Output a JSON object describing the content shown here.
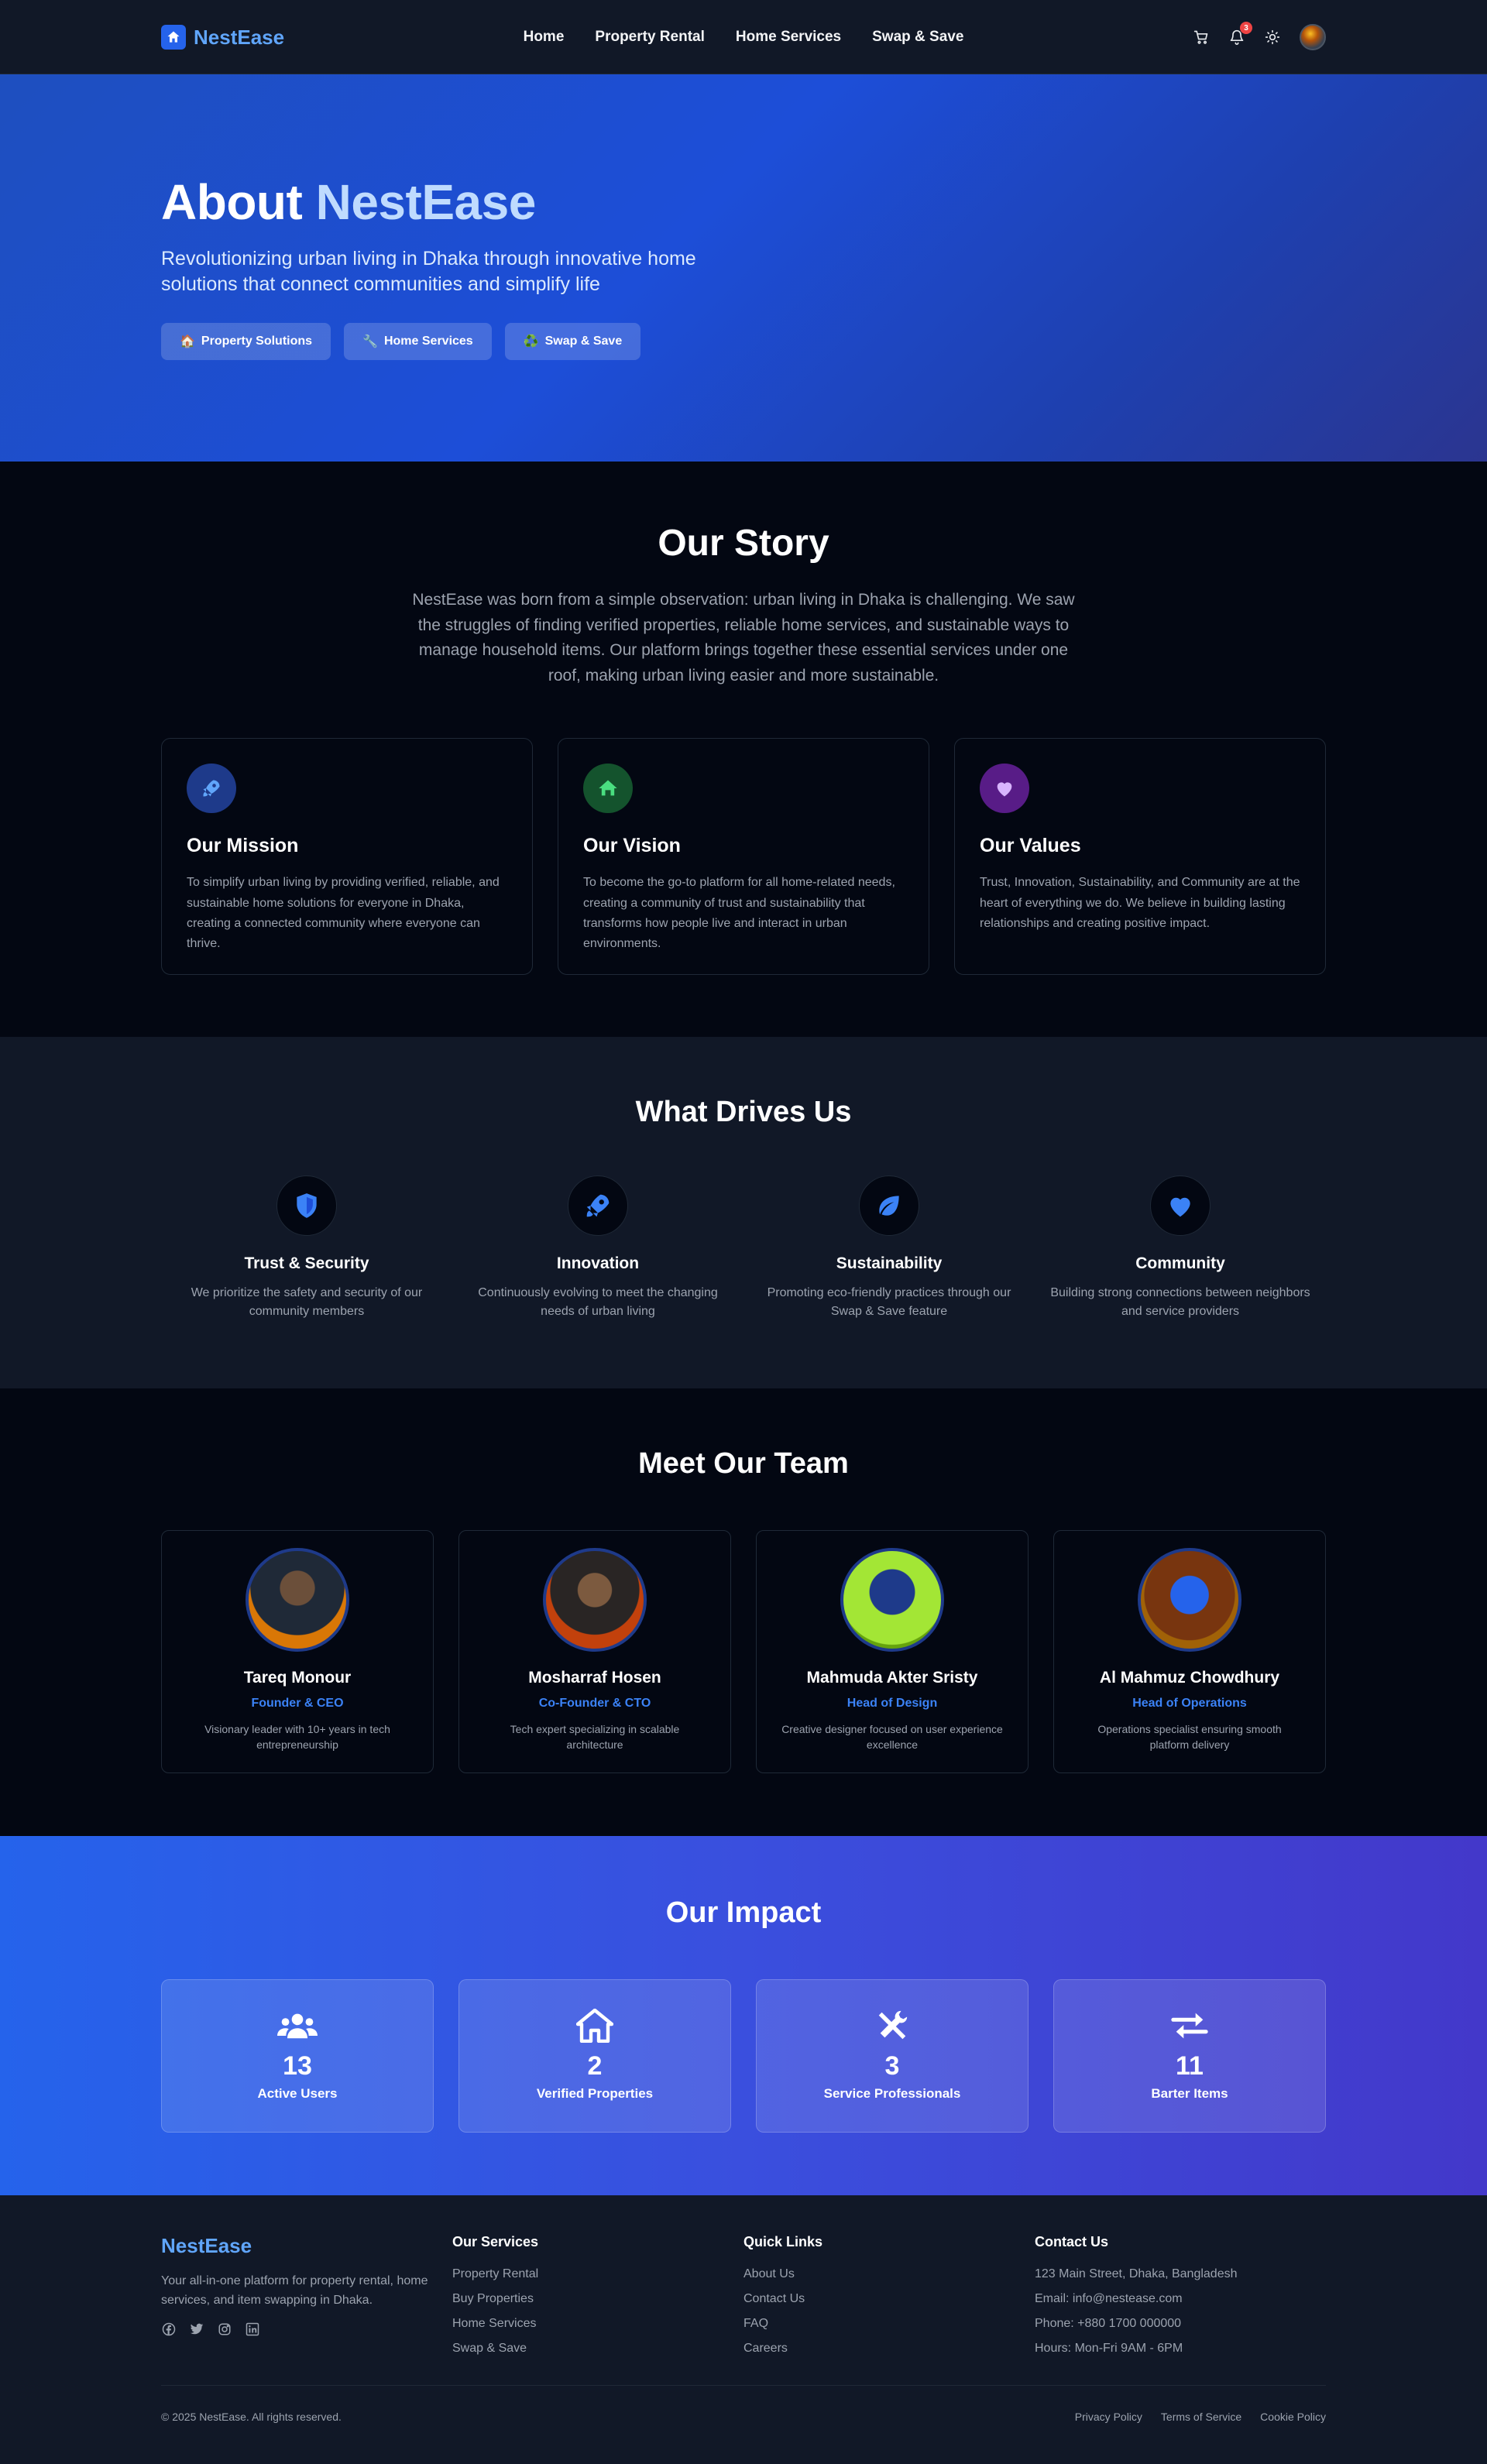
{
  "nav": {
    "brand": "NestEase",
    "links": [
      "Home",
      "Property Rental",
      "Home Services",
      "Swap & Save"
    ],
    "notification_count": "3",
    "icons": [
      "cart-icon",
      "bell-icon",
      "sun-icon",
      "avatar"
    ]
  },
  "hero": {
    "title_prefix": "About",
    "title_accent": "NestEase",
    "subtitle": "Revolutionizing urban living in Dhaka through innovative home solutions that connect communities and simplify life",
    "pills": [
      {
        "emoji": "🏠",
        "label": "Property Solutions"
      },
      {
        "emoji": "🔧",
        "label": "Home Services"
      },
      {
        "emoji": "♻️",
        "label": "Swap & Save"
      }
    ]
  },
  "story": {
    "title": "Our Story",
    "text": "NestEase was born from a simple observation: urban living in Dhaka is challenging. We saw the struggles of finding verified properties, reliable home services, and sustainable ways to manage household items. Our platform brings together these essential services under one roof, making urban living easier and more sustainable.",
    "cards": [
      {
        "icon": "rocket-icon",
        "title": "Our Mission",
        "text": "To simplify urban living by providing verified, reliable, and sustainable home solutions for everyone in Dhaka, creating a connected community where everyone can thrive."
      },
      {
        "icon": "home-icon",
        "title": "Our Vision",
        "text": "To become the go-to platform for all home-related needs, creating a community of trust and sustainability that transforms how people live and interact in urban environments."
      },
      {
        "icon": "heart-icon",
        "title": "Our Values",
        "text": "Trust, Innovation, Sustainability, and Community are at the heart of everything we do. We believe in building lasting relationships and creating positive impact."
      }
    ]
  },
  "drives": {
    "title": "What Drives Us",
    "items": [
      {
        "icon": "shield-icon",
        "title": "Trust & Security",
        "text": "We prioritize the safety and security of our community members"
      },
      {
        "icon": "rocket-icon",
        "title": "Innovation",
        "text": "Continuously evolving to meet the changing needs of urban living"
      },
      {
        "icon": "leaf-icon",
        "title": "Sustainability",
        "text": "Promoting eco-friendly practices through our Swap & Save feature"
      },
      {
        "icon": "heart-icon",
        "title": "Community",
        "text": "Building strong connections between neighbors and service providers"
      }
    ]
  },
  "team": {
    "title": "Meet Our Team",
    "members": [
      {
        "name": "Tareq Monour",
        "role": "Founder & CEO",
        "bio": "Visionary leader with 10+ years in tech entrepreneurship"
      },
      {
        "name": "Mosharraf Hosen",
        "role": "Co-Founder & CTO",
        "bio": "Tech expert specializing in scalable architecture"
      },
      {
        "name": "Mahmuda Akter Sristy",
        "role": "Head of Design",
        "bio": "Creative designer focused on user experience excellence"
      },
      {
        "name": "Al Mahmuz Chowdhury",
        "role": "Head of Operations",
        "bio": "Operations specialist ensuring smooth platform delivery"
      }
    ]
  },
  "impact": {
    "title": "Our Impact",
    "stats": [
      {
        "icon": "users-icon",
        "value": "13",
        "label": "Active Users"
      },
      {
        "icon": "house-icon",
        "value": "2",
        "label": "Verified Properties"
      },
      {
        "icon": "tools-icon",
        "value": "3",
        "label": "Service Professionals"
      },
      {
        "icon": "exchange-icon",
        "value": "11",
        "label": "Barter Items"
      }
    ]
  },
  "footer": {
    "brand": "NestEase",
    "description": "Your all-in-one platform for property rental, home services, and item swapping in Dhaka.",
    "services_title": "Our Services",
    "services": [
      "Property Rental",
      "Buy Properties",
      "Home Services",
      "Swap & Save"
    ],
    "quick_title": "Quick Links",
    "quick": [
      "About Us",
      "Contact Us",
      "FAQ",
      "Careers"
    ],
    "contact_title": "Contact Us",
    "contact": [
      "123 Main Street, Dhaka, Bangladesh",
      "Email: info@nestease.com",
      "Phone: +880 1700 000000",
      "Hours: Mon-Fri 9AM - 6PM"
    ],
    "copyright": "© 2025 NestEase. All rights reserved.",
    "legal": [
      "Privacy Policy",
      "Terms of Service",
      "Cookie Policy"
    ]
  },
  "colors": {
    "accent": "#2563eb",
    "accent_light": "#60a5fa",
    "page_bg": "#030712",
    "panel_bg": "#111827"
  }
}
